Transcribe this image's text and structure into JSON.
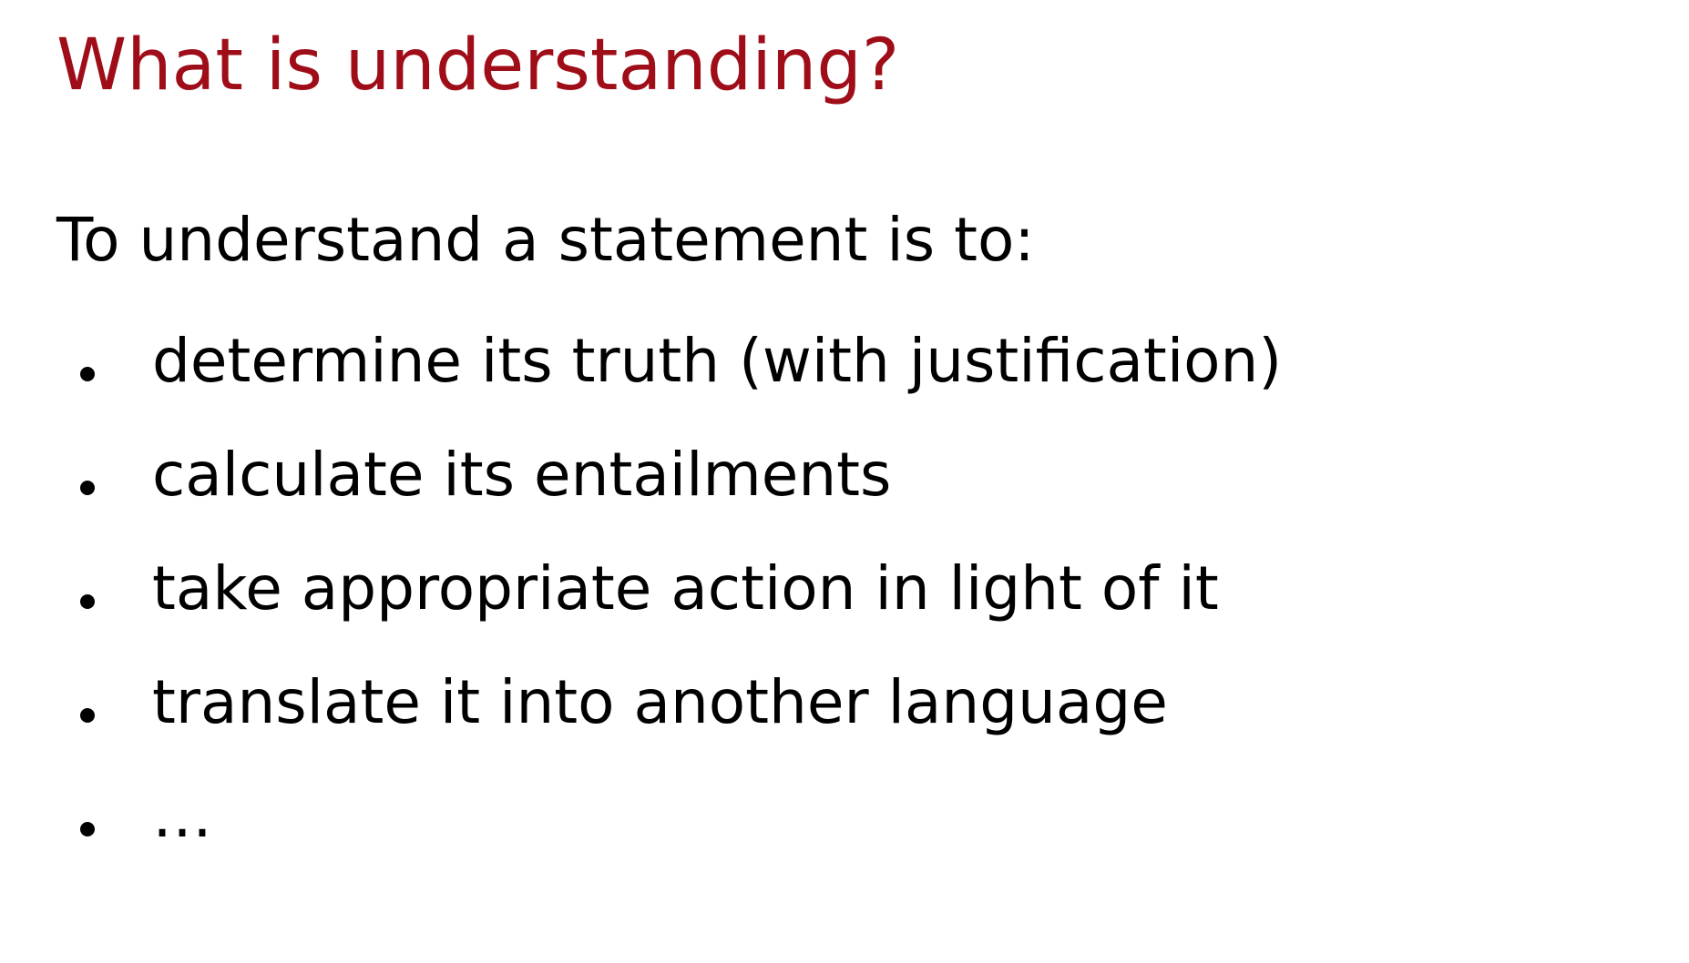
{
  "slide": {
    "title": "What is understanding?",
    "intro": "To understand a statement is to:",
    "bullets": [
      "determine its truth (with justification)",
      "calculate its entailments",
      "take appropriate action in light of it",
      "translate it into another language",
      "…"
    ]
  },
  "colors": {
    "title": "#9e0d18",
    "text": "#000000",
    "background": "#ffffff"
  }
}
